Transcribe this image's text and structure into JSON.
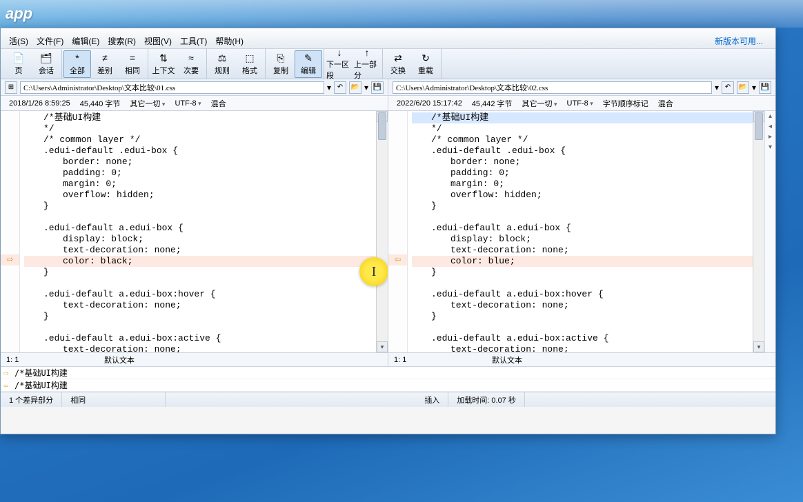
{
  "app_title": "app",
  "menu": [
    "活(S)",
    "文件(F)",
    "编辑(E)",
    "搜索(R)",
    "视图(V)",
    "工具(T)",
    "帮助(H)"
  ],
  "new_version": "新版本可用...",
  "toolbar": [
    {
      "icon": "📄",
      "label": "页"
    },
    {
      "icon": "🗂",
      "label": "会话"
    },
    {
      "icon": "*",
      "label": "全部",
      "active": true
    },
    {
      "icon": "≠",
      "label": "差别"
    },
    {
      "icon": "=",
      "label": "相同"
    },
    {
      "icon": "⇅",
      "label": "上下文"
    },
    {
      "icon": "≈",
      "label": "次要"
    },
    {
      "icon": "⚖",
      "label": "规则"
    },
    {
      "icon": "⬚",
      "label": "格式"
    },
    {
      "icon": "⎘",
      "label": "复制"
    },
    {
      "icon": "✎",
      "label": "编辑",
      "active": true
    },
    {
      "icon": "↓",
      "label": "下一区段"
    },
    {
      "icon": "↑",
      "label": "上一部分"
    },
    {
      "icon": "⇄",
      "label": "交换"
    },
    {
      "icon": "↻",
      "label": "重载"
    }
  ],
  "left": {
    "path": "C:\\Users\\Administrator\\Desktop\\文本比较\\01.css",
    "date": "2018/1/26 8:59:25",
    "size": "45,440 字节",
    "extra": "其它一切",
    "encoding": "UTF-8",
    "eol": "混合",
    "pos": "1: 1",
    "default": "默认文本",
    "lines": [
      {
        "t": "/*基础UI构建",
        "cls": "ind1"
      },
      {
        "t": "*/",
        "cls": "ind1"
      },
      {
        "t": "/* common layer */",
        "cls": "ind1"
      },
      {
        "t": ".edui-default .edui-box {",
        "cls": "ind1"
      },
      {
        "t": "border: none;",
        "cls": "ind2"
      },
      {
        "t": "padding: 0;",
        "cls": "ind2"
      },
      {
        "t": "margin: 0;",
        "cls": "ind2"
      },
      {
        "t": "overflow: hidden;",
        "cls": "ind2"
      },
      {
        "t": "}",
        "cls": "ind1"
      },
      {
        "t": "",
        "cls": ""
      },
      {
        "t": ".edui-default a.edui-box {",
        "cls": "ind1"
      },
      {
        "t": "display: block;",
        "cls": "ind2"
      },
      {
        "t": "text-decoration: none;",
        "cls": "ind2"
      },
      {
        "t": "color: black;",
        "cls": "ind2",
        "diff": true,
        "arrow": "⇨"
      },
      {
        "t": "}",
        "cls": "ind1"
      },
      {
        "t": "",
        "cls": ""
      },
      {
        "t": ".edui-default a.edui-box:hover {",
        "cls": "ind1"
      },
      {
        "t": "text-decoration: none;",
        "cls": "ind2"
      },
      {
        "t": "}",
        "cls": "ind1"
      },
      {
        "t": "",
        "cls": ""
      },
      {
        "t": ".edui-default a.edui-box:active {",
        "cls": "ind1"
      },
      {
        "t": "text-decoration: none;",
        "cls": "ind2"
      },
      {
        "t": "}",
        "cls": "ind1"
      }
    ]
  },
  "right": {
    "path": "C:\\Users\\Administrator\\Desktop\\文本比较\\02.css",
    "date": "2022/6/20 15:17:42",
    "size": "45,442 字节",
    "extra": "其它一切",
    "encoding": "UTF-8",
    "bom": "字节顺序标记",
    "eol": "混合",
    "pos": "1: 1",
    "default": "默认文本",
    "lines": [
      {
        "t": "/*基础UI构建",
        "cls": "ind1",
        "hl": true
      },
      {
        "t": "*/",
        "cls": "ind1"
      },
      {
        "t": "/* common layer */",
        "cls": "ind1"
      },
      {
        "t": ".edui-default .edui-box {",
        "cls": "ind1"
      },
      {
        "t": "border: none;",
        "cls": "ind2"
      },
      {
        "t": "padding: 0;",
        "cls": "ind2"
      },
      {
        "t": "margin: 0;",
        "cls": "ind2"
      },
      {
        "t": "overflow: hidden;",
        "cls": "ind2"
      },
      {
        "t": "}",
        "cls": "ind1"
      },
      {
        "t": "",
        "cls": ""
      },
      {
        "t": ".edui-default a.edui-box {",
        "cls": "ind1"
      },
      {
        "t": "display: block;",
        "cls": "ind2"
      },
      {
        "t": "text-decoration: none;",
        "cls": "ind2"
      },
      {
        "t": "color: blue;",
        "cls": "ind2",
        "diff": true,
        "arrow": "⇦"
      },
      {
        "t": "}",
        "cls": "ind1"
      },
      {
        "t": "",
        "cls": ""
      },
      {
        "t": ".edui-default a.edui-box:hover {",
        "cls": "ind1"
      },
      {
        "t": "text-decoration: none;",
        "cls": "ind2"
      },
      {
        "t": "}",
        "cls": "ind1"
      },
      {
        "t": "",
        "cls": ""
      },
      {
        "t": ".edui-default a.edui-box:active {",
        "cls": "ind1"
      },
      {
        "t": "text-decoration: none;",
        "cls": "ind2"
      },
      {
        "t": "}",
        "cls": "ind1"
      }
    ]
  },
  "sync": [
    {
      "arrow": "⇨",
      "text": "/*基础UI构建"
    },
    {
      "arrow": "⇦",
      "text": "/*基础UI构建"
    }
  ],
  "status": {
    "diff": "1 个差异部分",
    "same": "相同",
    "insert": "插入",
    "load": "加载时间: 0.07 秒"
  }
}
